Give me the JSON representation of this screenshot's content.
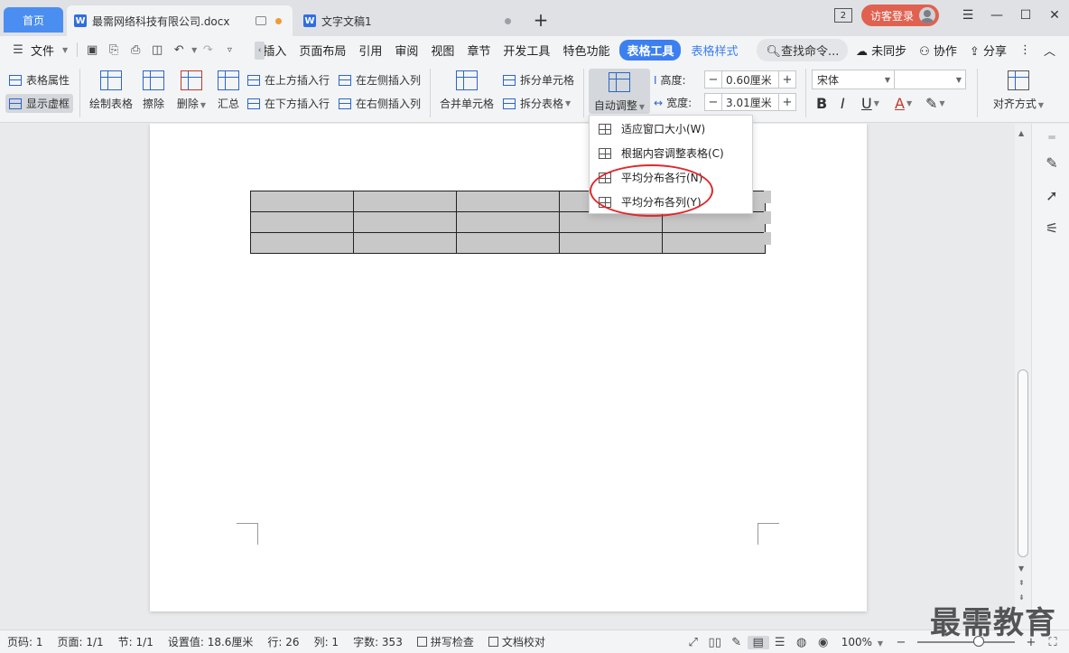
{
  "tabs": {
    "home": "首页",
    "active_doc": "最需网络科技有限公司.docx",
    "second_doc": "文字文稿1"
  },
  "titlebar": {
    "window_count": "2",
    "login": "访客登录"
  },
  "menu": {
    "file": "文件",
    "items": [
      "插入",
      "页面布局",
      "引用",
      "审阅",
      "视图",
      "章节",
      "开发工具",
      "特色功能"
    ],
    "active_tab": "表格工具",
    "style_tab": "表格样式",
    "search": "查找命令...",
    "sync": "未同步",
    "collab": "协作",
    "share": "分享"
  },
  "ribbon": {
    "table_props": "表格属性",
    "show_grid": "显示虚框",
    "draw_table": "绘制表格",
    "erase": "擦除",
    "delete": "删除",
    "summary": "汇总",
    "insert_above": "在上方插入行",
    "insert_below": "在下方插入行",
    "insert_left": "在左侧插入列",
    "insert_right": "在右侧插入列",
    "merge": "合并单元格",
    "split_cells": "拆分单元格",
    "split_table": "拆分表格",
    "auto_adjust": "自动调整",
    "height_label": "高度:",
    "height_value": "0.60厘米",
    "width_label": "宽度:",
    "width_value": "3.01厘米",
    "font": "宋体",
    "align": "对齐方式"
  },
  "dropdown": {
    "items": [
      {
        "label": "适应窗口大小(W)"
      },
      {
        "label": "根据内容调整表格(C)"
      },
      {
        "label": "平均分布各行(N)"
      },
      {
        "label": "平均分布各列(Y)"
      }
    ]
  },
  "statusbar": {
    "page": "页码: 1",
    "pages": "页面: 1/1",
    "section": "节: 1/1",
    "setting": "设置值: 18.6厘米",
    "row": "行: 26",
    "col": "列: 1",
    "words": "字数: 353",
    "spell": "拼写检查",
    "proof": "文档校对",
    "zoom": "100%"
  },
  "watermark": "最需教育",
  "colors": {
    "accent": "#3c7ff0",
    "annotation": "#e0282c",
    "login": "#e0614f"
  }
}
